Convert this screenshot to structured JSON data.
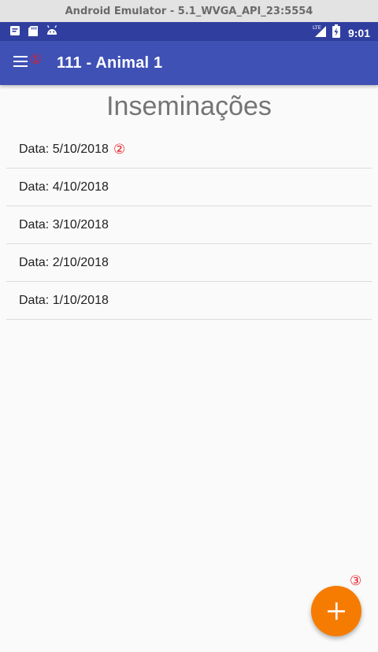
{
  "window": {
    "title": "Android Emulator - 5.1_WVGA_API_23:5554"
  },
  "status_bar": {
    "time": "9:01",
    "left_icons": [
      "notification-icon",
      "sd-card-icon",
      "android-icon"
    ],
    "right_icons": [
      "lte-signal-icon",
      "battery-icon"
    ]
  },
  "app_bar": {
    "title": "111 - Animal 1",
    "menu_icon": "hamburger-menu-icon",
    "color": "#3f51b5"
  },
  "page": {
    "heading": "Inseminações",
    "items": [
      {
        "label": "Data: 5/10/2018"
      },
      {
        "label": "Data: 4/10/2018"
      },
      {
        "label": "Data: 3/10/2018"
      },
      {
        "label": "Data: 2/10/2018"
      },
      {
        "label": "Data: 1/10/2018"
      }
    ]
  },
  "fab": {
    "icon": "plus-icon",
    "color": "#f57c00"
  },
  "annotations": {
    "marker_1": "①",
    "marker_2": "②",
    "marker_3": "③"
  },
  "colors": {
    "status_bar": "#303f9f",
    "accent": "#f57c00",
    "annotation": "#e51c23"
  }
}
